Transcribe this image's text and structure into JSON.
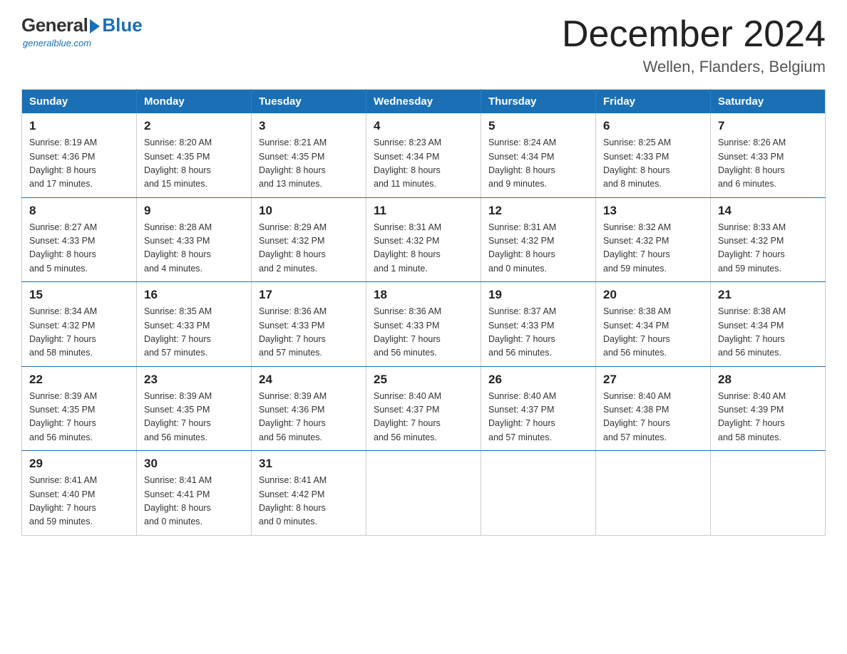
{
  "header": {
    "logo_general": "General",
    "logo_blue": "Blue",
    "logo_tagline": "generalblue.com",
    "title": "December 2024",
    "subtitle": "Wellen, Flanders, Belgium"
  },
  "calendar": {
    "columns": [
      "Sunday",
      "Monday",
      "Tuesday",
      "Wednesday",
      "Thursday",
      "Friday",
      "Saturday"
    ],
    "weeks": [
      [
        {
          "day": "1",
          "info": "Sunrise: 8:19 AM\nSunset: 4:36 PM\nDaylight: 8 hours\nand 17 minutes."
        },
        {
          "day": "2",
          "info": "Sunrise: 8:20 AM\nSunset: 4:35 PM\nDaylight: 8 hours\nand 15 minutes."
        },
        {
          "day": "3",
          "info": "Sunrise: 8:21 AM\nSunset: 4:35 PM\nDaylight: 8 hours\nand 13 minutes."
        },
        {
          "day": "4",
          "info": "Sunrise: 8:23 AM\nSunset: 4:34 PM\nDaylight: 8 hours\nand 11 minutes."
        },
        {
          "day": "5",
          "info": "Sunrise: 8:24 AM\nSunset: 4:34 PM\nDaylight: 8 hours\nand 9 minutes."
        },
        {
          "day": "6",
          "info": "Sunrise: 8:25 AM\nSunset: 4:33 PM\nDaylight: 8 hours\nand 8 minutes."
        },
        {
          "day": "7",
          "info": "Sunrise: 8:26 AM\nSunset: 4:33 PM\nDaylight: 8 hours\nand 6 minutes."
        }
      ],
      [
        {
          "day": "8",
          "info": "Sunrise: 8:27 AM\nSunset: 4:33 PM\nDaylight: 8 hours\nand 5 minutes."
        },
        {
          "day": "9",
          "info": "Sunrise: 8:28 AM\nSunset: 4:33 PM\nDaylight: 8 hours\nand 4 minutes."
        },
        {
          "day": "10",
          "info": "Sunrise: 8:29 AM\nSunset: 4:32 PM\nDaylight: 8 hours\nand 2 minutes."
        },
        {
          "day": "11",
          "info": "Sunrise: 8:31 AM\nSunset: 4:32 PM\nDaylight: 8 hours\nand 1 minute."
        },
        {
          "day": "12",
          "info": "Sunrise: 8:31 AM\nSunset: 4:32 PM\nDaylight: 8 hours\nand 0 minutes."
        },
        {
          "day": "13",
          "info": "Sunrise: 8:32 AM\nSunset: 4:32 PM\nDaylight: 7 hours\nand 59 minutes."
        },
        {
          "day": "14",
          "info": "Sunrise: 8:33 AM\nSunset: 4:32 PM\nDaylight: 7 hours\nand 59 minutes."
        }
      ],
      [
        {
          "day": "15",
          "info": "Sunrise: 8:34 AM\nSunset: 4:32 PM\nDaylight: 7 hours\nand 58 minutes."
        },
        {
          "day": "16",
          "info": "Sunrise: 8:35 AM\nSunset: 4:33 PM\nDaylight: 7 hours\nand 57 minutes."
        },
        {
          "day": "17",
          "info": "Sunrise: 8:36 AM\nSunset: 4:33 PM\nDaylight: 7 hours\nand 57 minutes."
        },
        {
          "day": "18",
          "info": "Sunrise: 8:36 AM\nSunset: 4:33 PM\nDaylight: 7 hours\nand 56 minutes."
        },
        {
          "day": "19",
          "info": "Sunrise: 8:37 AM\nSunset: 4:33 PM\nDaylight: 7 hours\nand 56 minutes."
        },
        {
          "day": "20",
          "info": "Sunrise: 8:38 AM\nSunset: 4:34 PM\nDaylight: 7 hours\nand 56 minutes."
        },
        {
          "day": "21",
          "info": "Sunrise: 8:38 AM\nSunset: 4:34 PM\nDaylight: 7 hours\nand 56 minutes."
        }
      ],
      [
        {
          "day": "22",
          "info": "Sunrise: 8:39 AM\nSunset: 4:35 PM\nDaylight: 7 hours\nand 56 minutes."
        },
        {
          "day": "23",
          "info": "Sunrise: 8:39 AM\nSunset: 4:35 PM\nDaylight: 7 hours\nand 56 minutes."
        },
        {
          "day": "24",
          "info": "Sunrise: 8:39 AM\nSunset: 4:36 PM\nDaylight: 7 hours\nand 56 minutes."
        },
        {
          "day": "25",
          "info": "Sunrise: 8:40 AM\nSunset: 4:37 PM\nDaylight: 7 hours\nand 56 minutes."
        },
        {
          "day": "26",
          "info": "Sunrise: 8:40 AM\nSunset: 4:37 PM\nDaylight: 7 hours\nand 57 minutes."
        },
        {
          "day": "27",
          "info": "Sunrise: 8:40 AM\nSunset: 4:38 PM\nDaylight: 7 hours\nand 57 minutes."
        },
        {
          "day": "28",
          "info": "Sunrise: 8:40 AM\nSunset: 4:39 PM\nDaylight: 7 hours\nand 58 minutes."
        }
      ],
      [
        {
          "day": "29",
          "info": "Sunrise: 8:41 AM\nSunset: 4:40 PM\nDaylight: 7 hours\nand 59 minutes."
        },
        {
          "day": "30",
          "info": "Sunrise: 8:41 AM\nSunset: 4:41 PM\nDaylight: 8 hours\nand 0 minutes."
        },
        {
          "day": "31",
          "info": "Sunrise: 8:41 AM\nSunset: 4:42 PM\nDaylight: 8 hours\nand 0 minutes."
        },
        {
          "day": "",
          "info": ""
        },
        {
          "day": "",
          "info": ""
        },
        {
          "day": "",
          "info": ""
        },
        {
          "day": "",
          "info": ""
        }
      ]
    ]
  }
}
